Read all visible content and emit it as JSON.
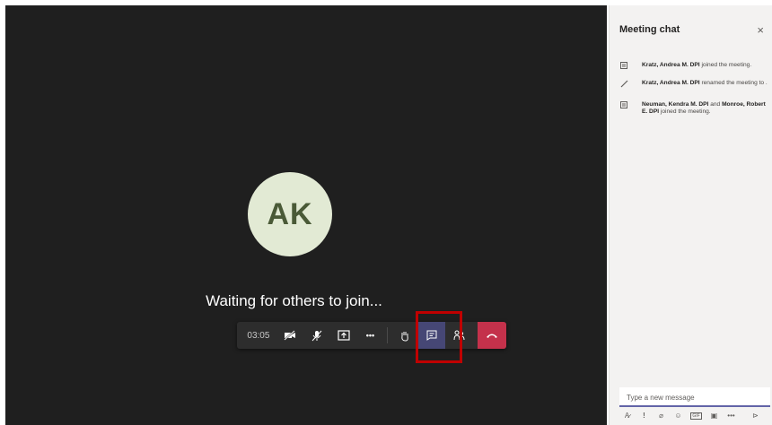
{
  "stage": {
    "avatar_initials": "AK",
    "waiting_text": "Waiting for others to join..."
  },
  "toolbar": {
    "timer": "03:05",
    "buttons": [
      "camera-off",
      "mic-off",
      "share",
      "more",
      "raise-hand",
      "chat",
      "participants",
      "hang-up"
    ],
    "more_label": "•••",
    "end_color": "#c4314b",
    "chat_active_color": "#464775"
  },
  "chat": {
    "title": "Meeting chat",
    "close": "×",
    "messages": [
      {
        "name": "Kratz, Andrea M. DPI",
        "text": " joined the meeting.",
        "icon": "join-icon"
      },
      {
        "name": "Kratz, Andrea M. DPI",
        "text": " renamed the meeting to .",
        "icon": "pencil-icon"
      },
      {
        "name1": "Neuman, Kendra M. DPI",
        "mid": " and ",
        "name2": "Monroe, Robert E. DPI",
        "text": " joined the meeting.",
        "icon": "join-icon"
      }
    ],
    "compose_placeholder": "Type a new message",
    "compose_tools": [
      "A̷",
      "!",
      "⌀",
      "☺",
      "GIF",
      "▣",
      "•••",
      "⊳"
    ]
  },
  "colors": {
    "stage_bg": "#1f1f1f",
    "accent": "#6264a7",
    "highlight": "#c00000"
  }
}
